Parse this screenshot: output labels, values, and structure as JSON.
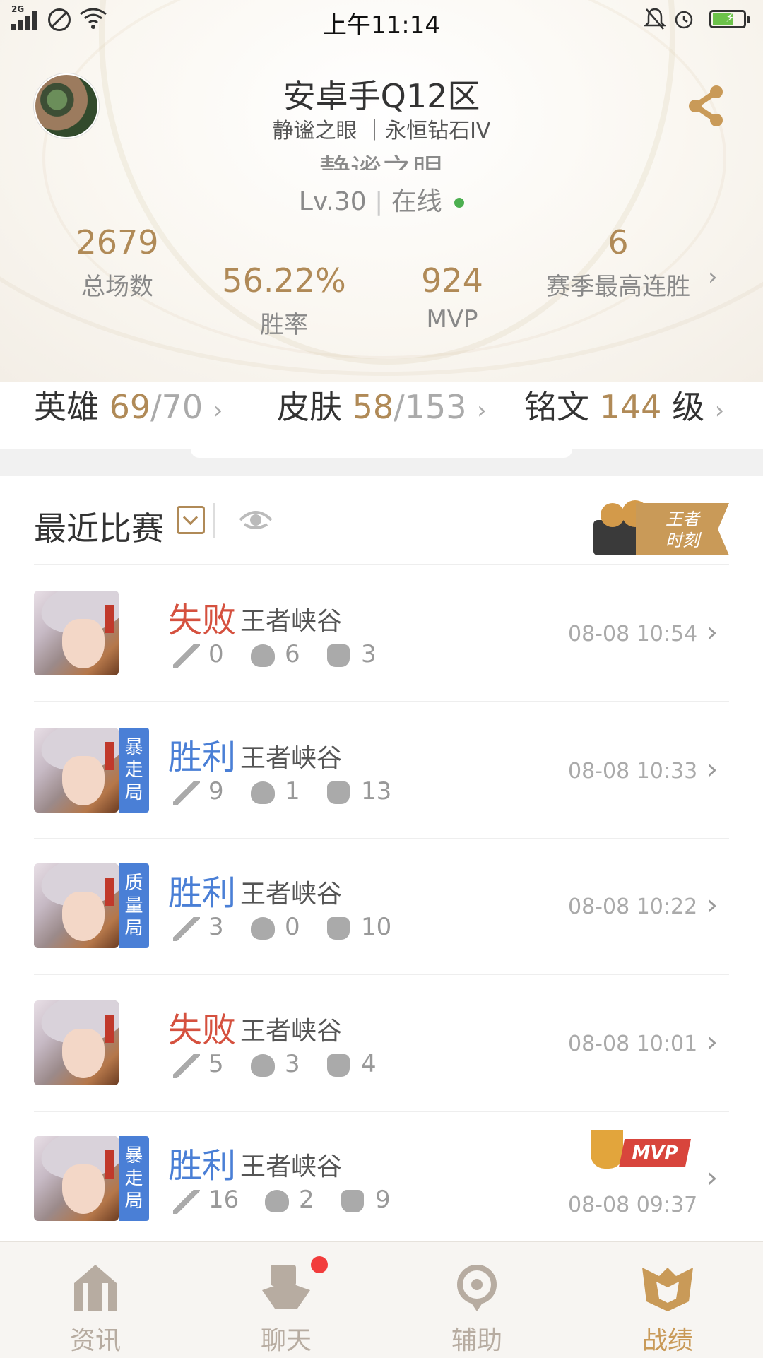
{
  "status_bar": {
    "network": "2G",
    "time": "上午11:14"
  },
  "header": {
    "title": "安卓手Q12区",
    "subtitle": "静谧之眼 ｜永恒钻石IV",
    "ghost_name": "静谧之眼",
    "level": "Lv.30",
    "online": "在线"
  },
  "stats": {
    "total_games": {
      "value": "2679",
      "label": "总场数"
    },
    "win_rate": {
      "value": "56.22%",
      "label": "胜率"
    },
    "mvp": {
      "value": "924",
      "label": "MVP"
    },
    "streak": {
      "value": "6",
      "label": "赛季最高连胜"
    }
  },
  "counts": {
    "heroes": {
      "label": "英雄",
      "have": "69",
      "total": "/70"
    },
    "skins": {
      "label": "皮肤",
      "have": "58",
      "total": "/153"
    },
    "runes": {
      "label": "铭文",
      "value": "144",
      "unit": "级"
    }
  },
  "recent": {
    "title": "最近比赛",
    "moment_badge": "王者\n时刻"
  },
  "matches": [
    {
      "result": "失败",
      "map": "王者峡谷",
      "kills": "0",
      "deaths": "6",
      "assists": "3",
      "time": "08-08 10:54",
      "tag": ""
    },
    {
      "result": "胜利",
      "map": "王者峡谷",
      "kills": "9",
      "deaths": "1",
      "assists": "13",
      "time": "08-08 10:33",
      "tag": "暴\n走\n局"
    },
    {
      "result": "胜利",
      "map": "王者峡谷",
      "kills": "3",
      "deaths": "0",
      "assists": "10",
      "time": "08-08 10:22",
      "tag": "质\n量\n局"
    },
    {
      "result": "失败",
      "map": "王者峡谷",
      "kills": "5",
      "deaths": "3",
      "assists": "4",
      "time": "08-08 10:01",
      "tag": ""
    },
    {
      "result": "胜利",
      "map": "王者峡谷",
      "kills": "16",
      "deaths": "2",
      "assists": "9",
      "time": "08-08 09:37",
      "tag": "暴\n走\n局",
      "mvp": "MVP"
    }
  ],
  "nav": [
    {
      "label": "资讯"
    },
    {
      "label": "聊天"
    },
    {
      "label": "辅助"
    },
    {
      "label": "战绩"
    }
  ]
}
